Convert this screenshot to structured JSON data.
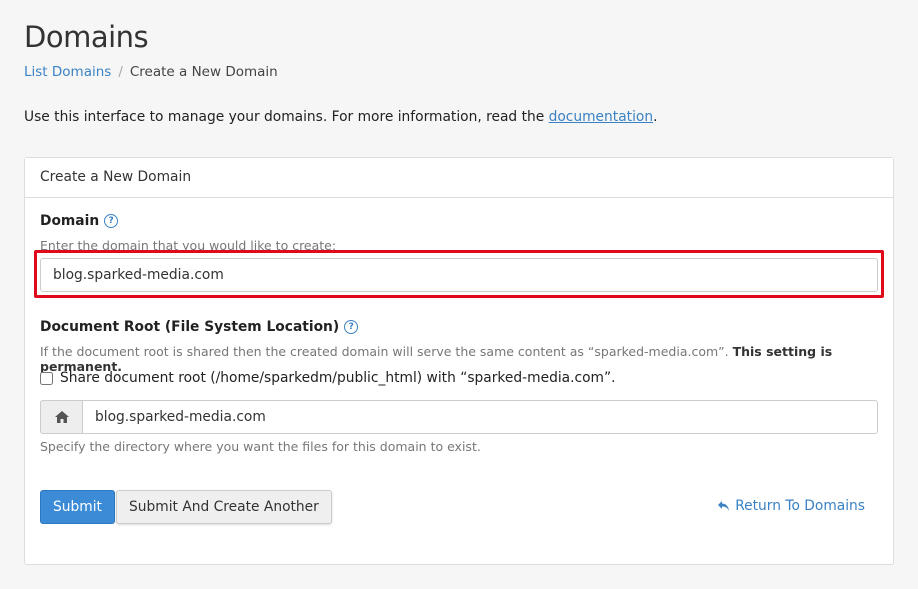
{
  "page": {
    "title": "Domains",
    "intro_text": "Use this interface to manage your domains. For more information, read the ",
    "intro_link": "documentation",
    "intro_end": "."
  },
  "breadcrumb": {
    "items": [
      "List Domains",
      "Create a New Domain"
    ],
    "separator": "/"
  },
  "panel": {
    "heading": "Create a New Domain",
    "domain": {
      "label": "Domain",
      "hint": "Enter the domain that you would like to create:",
      "value": "blog.sparked-media.com"
    },
    "docroot": {
      "label": "Document Root (File System Location)",
      "hint_text": "If the document root is shared then the created domain will serve the same content as “sparked-media.com”. ",
      "hint_bold": "This setting is permanent.",
      "checkbox_label": "Share document root (/home/sparkedm/public_html) with “sparked-media.com”.",
      "checkbox_checked": false,
      "value": "blog.sparked-media.com",
      "addon_icon": "home-icon",
      "help": "Specify the directory where you want the files for this domain to exist."
    },
    "buttons": {
      "submit": "Submit",
      "submit_another": "Submit And Create Another",
      "return": "Return To Domains"
    }
  },
  "colors": {
    "link": "#3b82c4",
    "primary": "#3b8bd6",
    "highlight": "#e0081b"
  }
}
